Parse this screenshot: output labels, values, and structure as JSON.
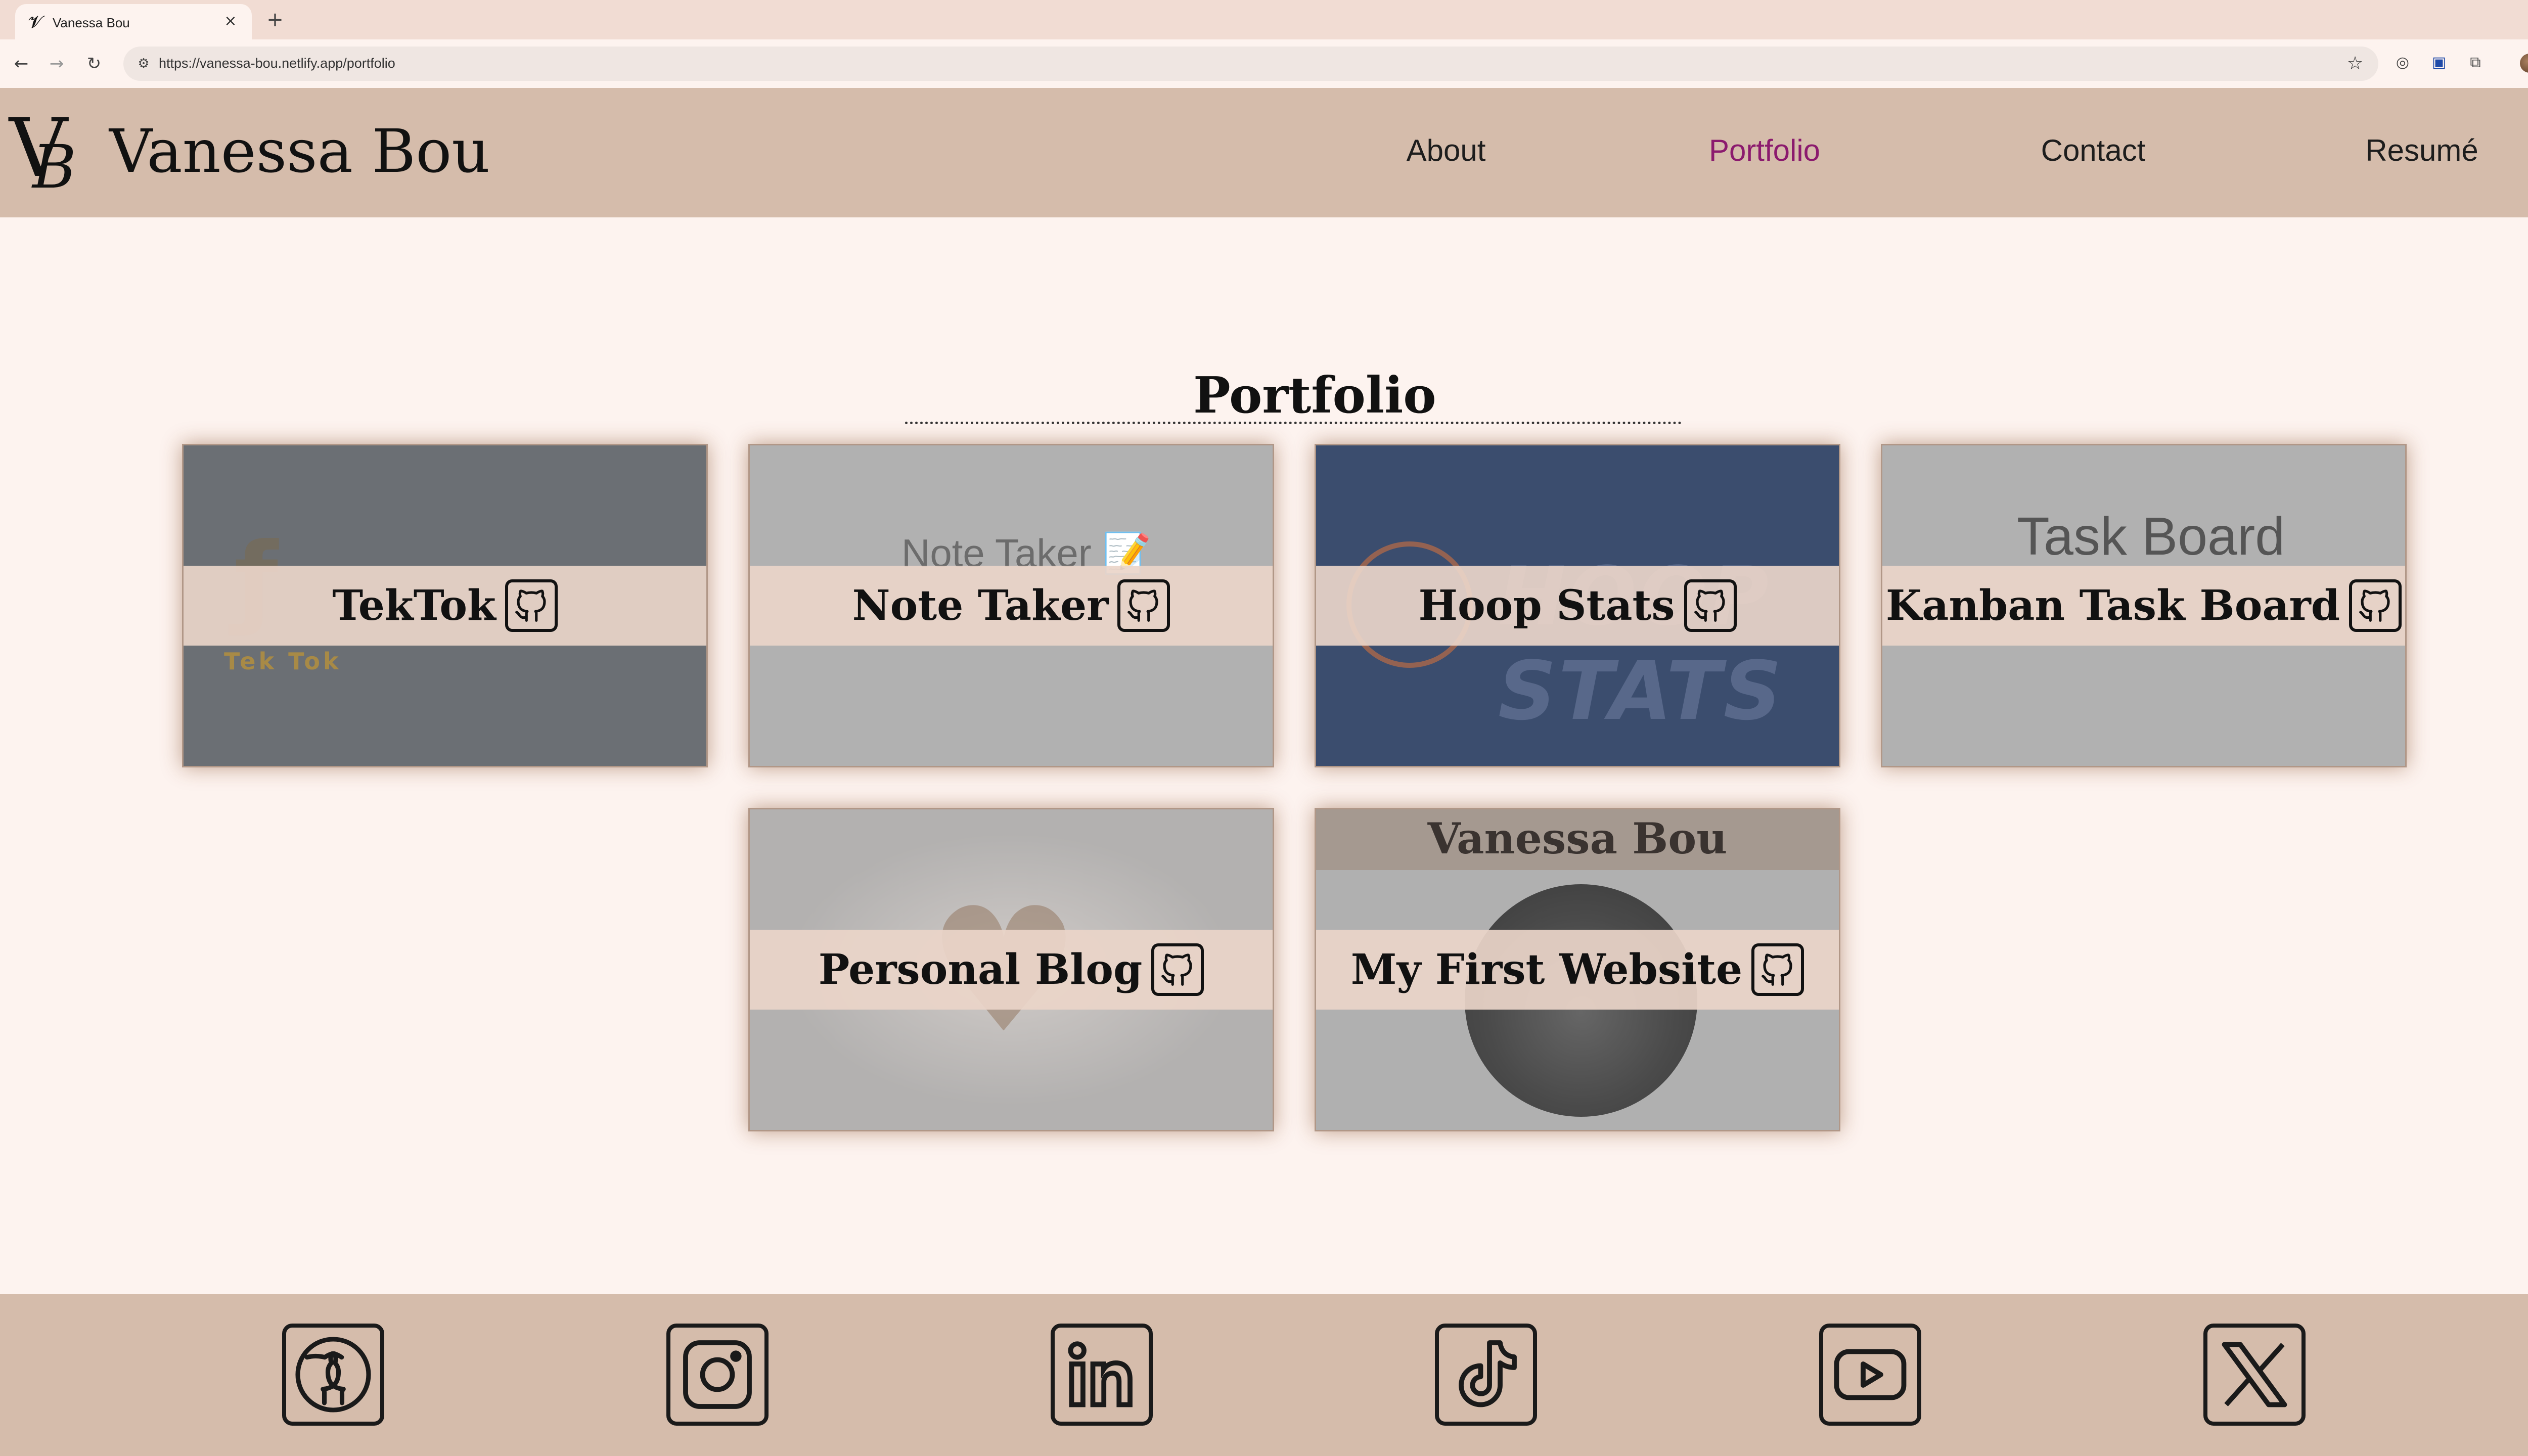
{
  "browser": {
    "tab_title": "Vanessa Bou",
    "favicon": "VB",
    "url": "https://vanessa-bou.netlify.app/portfolio"
  },
  "site": {
    "logo_v": "V",
    "logo_b": "B",
    "name": "Vanessa Bou",
    "nav": [
      {
        "label": "About"
      },
      {
        "label": "Portfolio"
      },
      {
        "label": "Contact"
      },
      {
        "label": "Resumé"
      }
    ]
  },
  "portfolio": {
    "title": "Portfolio",
    "projects": [
      {
        "title": "TekTok",
        "thumb_text": "Tek Tok",
        "bg": "#6b6f74"
      },
      {
        "title": "Note Taker",
        "thumb_text": "Note Taker 📝",
        "bg": "#b1b1b1"
      },
      {
        "title": "Hoop Stats",
        "thumb_text": "HOOP STATS",
        "bg": "#3b4d6e"
      },
      {
        "title": "Kanban Task Board",
        "thumb_text": "Task Board",
        "bg": "#b1b1b1"
      },
      {
        "title": "Personal Blog",
        "bg": "#b3b1b0"
      },
      {
        "title": "My First Website",
        "thumb_text": "Vanessa Bou",
        "bg": "#b0b0b0"
      }
    ]
  },
  "footer": {
    "social": [
      {
        "icon": "github-icon"
      },
      {
        "icon": "instagram-icon"
      },
      {
        "icon": "linkedin-icon"
      },
      {
        "icon": "tiktok-icon"
      },
      {
        "icon": "youtube-icon"
      },
      {
        "icon": "x-icon"
      }
    ]
  },
  "colors": {
    "page_bg": "#fdf3ef",
    "header_bg": "#d5bcab",
    "nav_active": "#8b1a6e"
  }
}
